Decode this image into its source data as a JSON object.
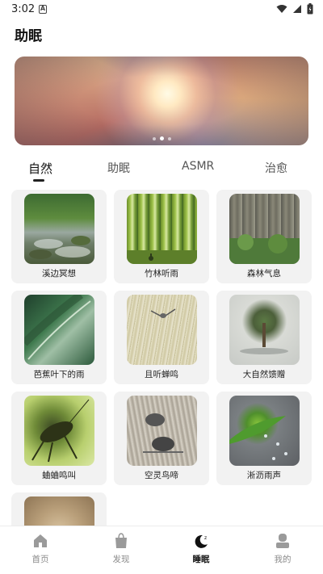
{
  "status_bar": {
    "time": "3:02",
    "notification_glyph": "A"
  },
  "header": {
    "title": "助眠"
  },
  "banner": {
    "dots": 3,
    "active_dot": 1
  },
  "tabs": [
    {
      "label": "自然",
      "active": true
    },
    {
      "label": "助眠",
      "active": false
    },
    {
      "label": "ASMR",
      "active": false
    },
    {
      "label": "治愈",
      "active": false
    }
  ],
  "items": [
    {
      "label": "溪边冥想",
      "icon": "stream-image"
    },
    {
      "label": "竹林听雨",
      "icon": "bamboo-image"
    },
    {
      "label": "森林气息",
      "icon": "forest-image"
    },
    {
      "label": "芭蕉叶下的雨",
      "icon": "banana-leaf-image"
    },
    {
      "label": "且听蝉鸣",
      "icon": "cicada-image"
    },
    {
      "label": "大自然馈赠",
      "icon": "tree-image"
    },
    {
      "label": "蛐蛐鸣叫",
      "icon": "cricket-image"
    },
    {
      "label": "空灵鸟啼",
      "icon": "bird-image"
    },
    {
      "label": "淅沥雨声",
      "icon": "raindrop-leaf-image"
    },
    {
      "label": "",
      "icon": "wood-texture-image"
    }
  ],
  "bottom_nav": [
    {
      "label": "首页",
      "icon": "home-icon",
      "active": false
    },
    {
      "label": "发现",
      "icon": "bag-icon",
      "active": false
    },
    {
      "label": "睡眠",
      "icon": "moon-icon",
      "active": true
    },
    {
      "label": "我的",
      "icon": "profile-icon",
      "active": false
    }
  ],
  "colors": {
    "card_bg": "#f2f2f2",
    "active_text": "#111111",
    "inactive_text": "#8a8a8a"
  }
}
